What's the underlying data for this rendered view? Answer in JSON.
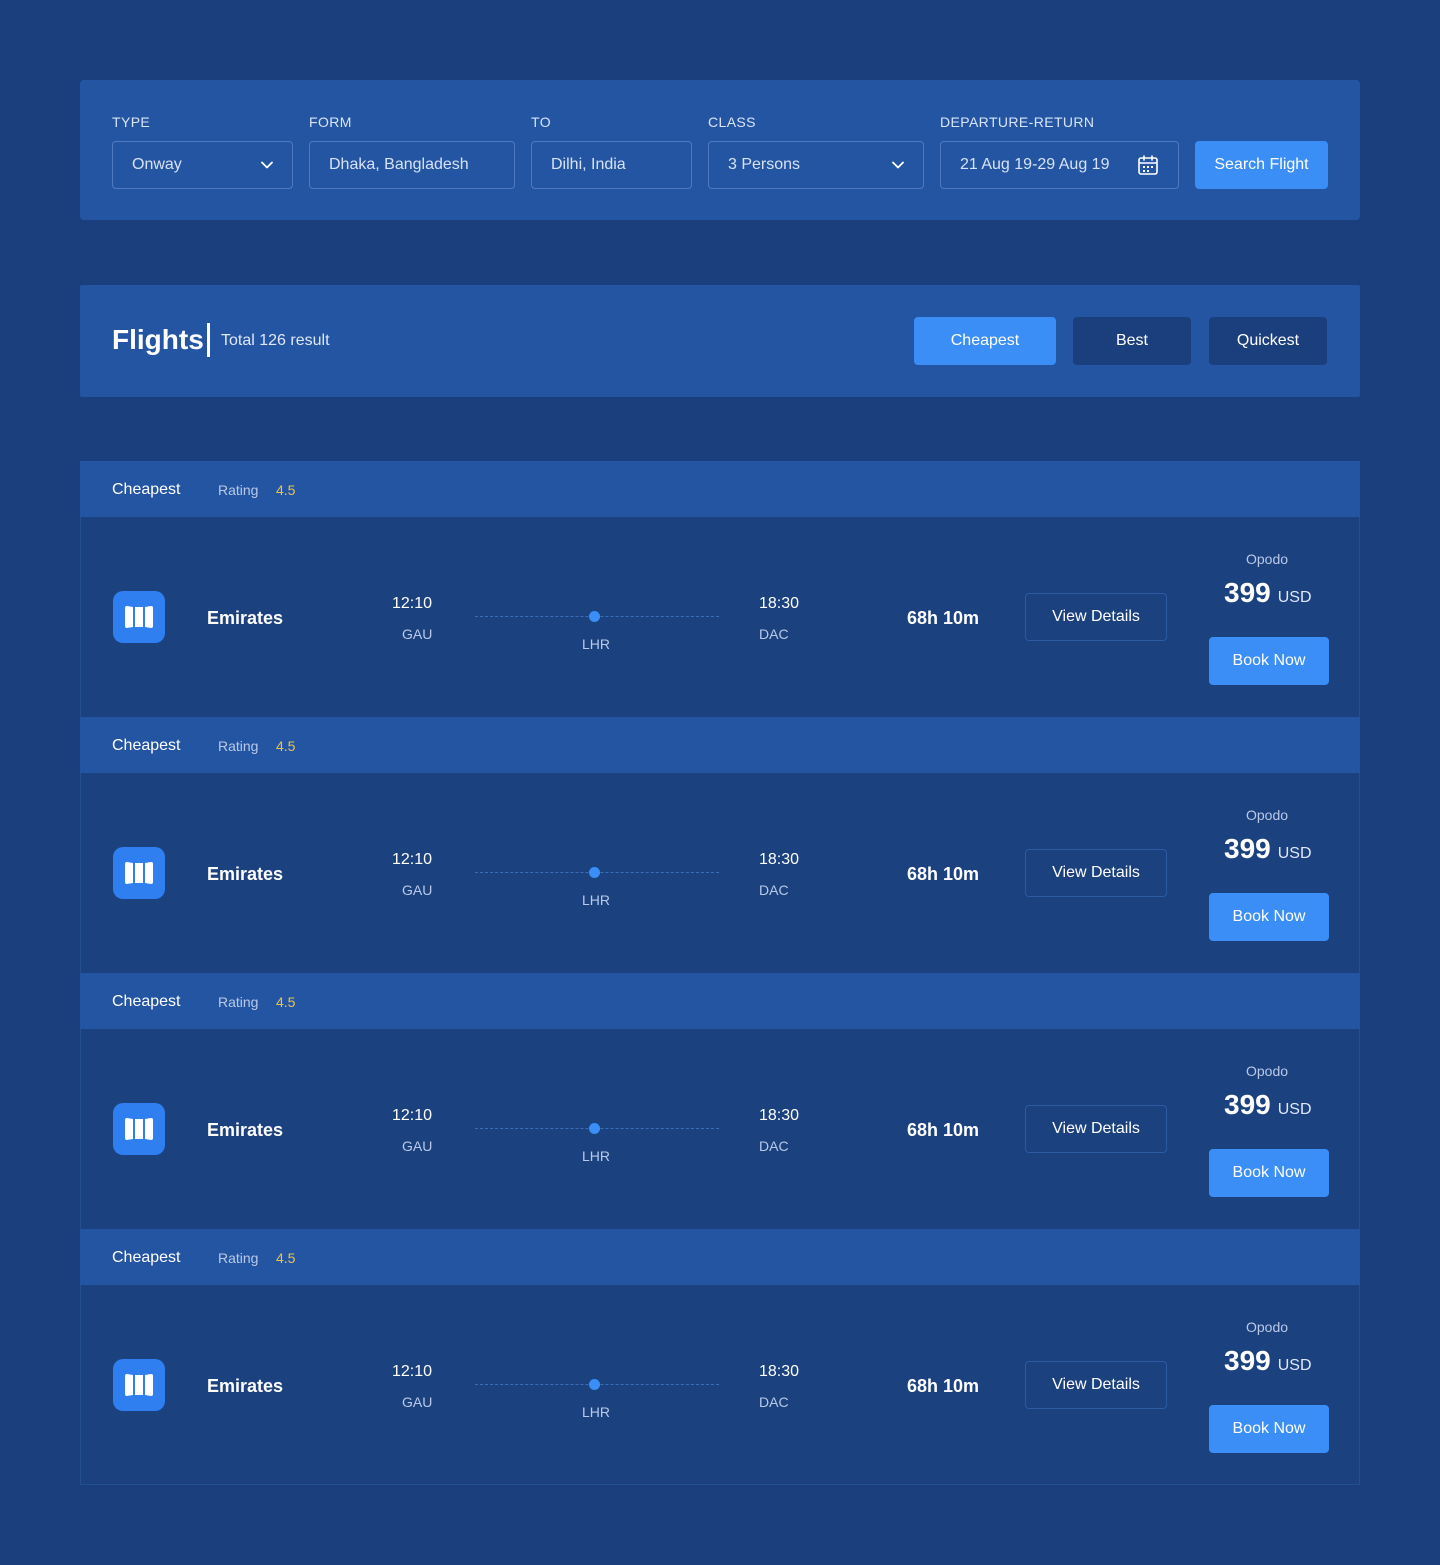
{
  "search": {
    "type": {
      "label": "TYPE",
      "value": "Onway"
    },
    "from": {
      "label": "FORM",
      "value": "Dhaka, Bangladesh"
    },
    "to": {
      "label": "TO",
      "value": "Dilhi, India"
    },
    "class": {
      "label": "CLASS",
      "value": "3 Persons"
    },
    "dates": {
      "label": "DEPARTURE-RETURN",
      "value": "21 Aug 19-29 Aug 19"
    },
    "button": "Search Flight"
  },
  "results": {
    "title": "Flights",
    "total": "Total 126 result",
    "sort": {
      "cheapest": "Cheapest",
      "best": "Best",
      "quickest": "Quickest"
    }
  },
  "flights": [
    {
      "tag": "Cheapest",
      "rating_label": "Rating",
      "rating": "4.5",
      "airline": "Emirates",
      "dep_time": "12:10",
      "dep_code": "GAU",
      "stop": "LHR",
      "arr_time": "18:30",
      "arr_code": "DAC",
      "duration": "68h 10m",
      "view": "View Details",
      "provider": "Opodo",
      "price": "399",
      "currency": "USD",
      "book": "Book Now"
    },
    {
      "tag": "Cheapest",
      "rating_label": "Rating",
      "rating": "4.5",
      "airline": "Emirates",
      "dep_time": "12:10",
      "dep_code": "GAU",
      "stop": "LHR",
      "arr_time": "18:30",
      "arr_code": "DAC",
      "duration": "68h 10m",
      "view": "View Details",
      "provider": "Opodo",
      "price": "399",
      "currency": "USD",
      "book": "Book Now"
    },
    {
      "tag": "Cheapest",
      "rating_label": "Rating",
      "rating": "4.5",
      "airline": "Emirates",
      "dep_time": "12:10",
      "dep_code": "GAU",
      "stop": "LHR",
      "arr_time": "18:30",
      "arr_code": "DAC",
      "duration": "68h 10m",
      "view": "View Details",
      "provider": "Opodo",
      "price": "399",
      "currency": "USD",
      "book": "Book Now"
    },
    {
      "tag": "Cheapest",
      "rating_label": "Rating",
      "rating": "4.5",
      "airline": "Emirates",
      "dep_time": "12:10",
      "dep_code": "GAU",
      "stop": "LHR",
      "arr_time": "18:30",
      "arr_code": "DAC",
      "duration": "68h 10m",
      "view": "View Details",
      "provider": "Opodo",
      "price": "399",
      "currency": "USD",
      "book": "Book Now"
    }
  ],
  "colors": {
    "background": "#1b3f7d",
    "panel": "#2455a3",
    "accent": "#3b8ef5",
    "rating": "#e7c34a"
  },
  "icons": {
    "dropdown": "chevron-down-icon",
    "calendar": "calendar-icon",
    "airline": "airline-logo-icon"
  }
}
